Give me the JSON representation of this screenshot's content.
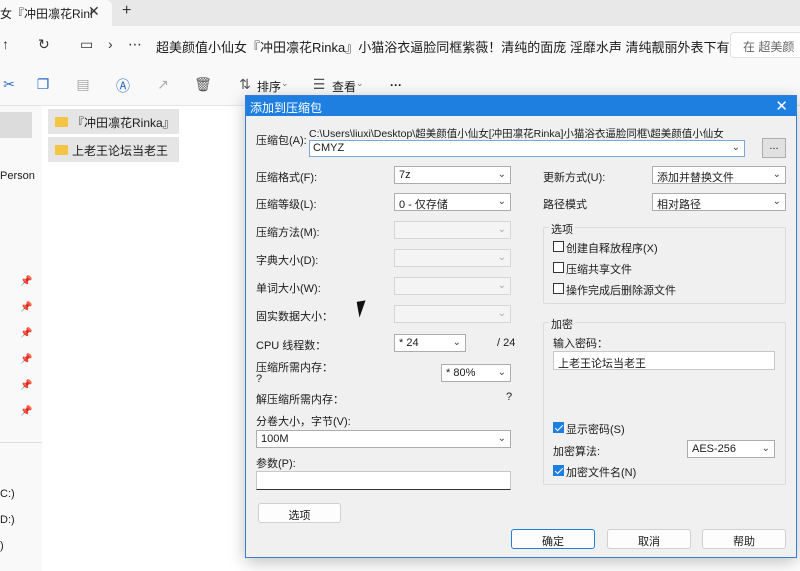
{
  "tab": {
    "title": "女『冲田凛花Rinl",
    "close": "✕",
    "new": "+"
  },
  "address": {
    "path": "超美颜值小仙女『冲田凛花Rinka』小猫浴衣逼脸同框紫薇！清纯的面庞 淫靡水声 清纯靓丽外表下有一颗淫",
    "search_placeholder": "在 超美颜"
  },
  "toolbar": {
    "sort_label": "排序",
    "view_label": "查看"
  },
  "sidebar": {
    "items": [
      "Person",
      "C:)",
      "D:)",
      ")"
    ]
  },
  "folders": [
    {
      "name": "『冲田凛花Rinka』"
    },
    {
      "name": "上老王论坛当老王"
    }
  ],
  "dialog": {
    "title": "添加到压缩包",
    "archive_label": "压缩包(A):",
    "archive_path": "C:\\Users\\liuxi\\Desktop\\超美颜值小仙女[冲田凛花Rinka]小猫浴衣逼脸同框\\超美颜值小仙女『冲田凛花Rinka』小",
    "archive_name": "CMYZ",
    "browse_label": "...",
    "left": {
      "format_label": "压缩格式(F):",
      "format_value": "7z",
      "level_label": "压缩等级(L):",
      "level_value": "0 - 仅存储",
      "method_label": "压缩方法(M):",
      "dict_label": "字典大小(D):",
      "word_label": "单词大小(W):",
      "solid_label": "固实数据大小：",
      "cpu_label": "CPU 线程数：",
      "cpu_value": "* 24",
      "cpu_total": "/ 24",
      "mem_label": "压缩所需内存：",
      "mem_q": "?",
      "mem_value": "* 80%",
      "decomp_label": "解压缩所需内存：",
      "decomp_value": "?",
      "split_label": "分卷大小，字节(V):",
      "split_value": "100M",
      "params_label": "参数(P):",
      "options_button": "选项"
    },
    "right": {
      "update_label": "更新方式(U):",
      "update_value": "添加并替换文件",
      "pathmode_label": "路径模式",
      "pathmode_value": "相对路径",
      "options_group": "选项",
      "opt_sfx": "创建自释放程序(X)",
      "opt_shared": "压缩共享文件",
      "opt_delete": "操作完成后删除源文件",
      "encrypt_group": "加密",
      "password_label": "输入密码：",
      "password_value": "上老王论坛当老王",
      "show_password": "显示密码(S)",
      "method_label": "加密算法:",
      "method_value": "AES-256",
      "encrypt_names": "加密文件名(N)"
    },
    "buttons": {
      "ok": "确定",
      "cancel": "取消",
      "help": "帮助"
    }
  },
  "colors": {
    "accent": "#1e7fe0",
    "folder": "#f4c542"
  }
}
